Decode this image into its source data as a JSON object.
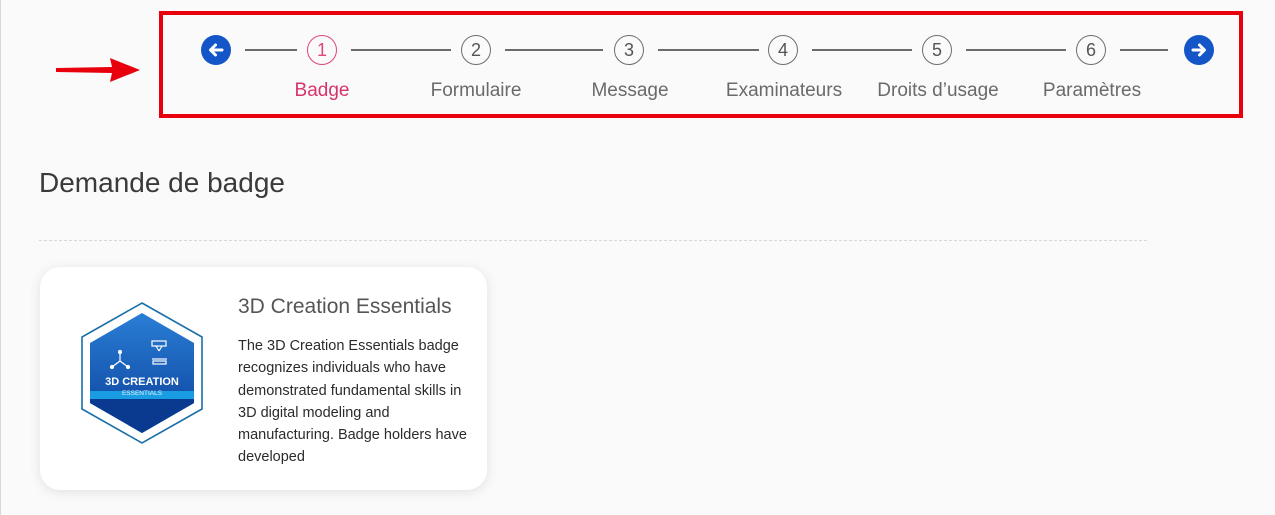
{
  "stepper": {
    "prev_icon": "arrow-left-icon",
    "next_icon": "arrow-right-icon",
    "active_color": "#d6336c",
    "nav_color": "#1456c8",
    "steps": [
      {
        "number": "1",
        "label": "Badge",
        "active": true
      },
      {
        "number": "2",
        "label": "Formulaire",
        "active": false
      },
      {
        "number": "3",
        "label": "Message",
        "active": false
      },
      {
        "number": "4",
        "label": "Examinateurs",
        "active": false
      },
      {
        "number": "5",
        "label": "Droits d’usage",
        "active": false
      },
      {
        "number": "6",
        "label": "Paramètres",
        "active": false
      }
    ]
  },
  "annotation": {
    "color": "#e8000d"
  },
  "page": {
    "title": "Demande de badge"
  },
  "badge": {
    "name": "3D Creation Essentials",
    "emblem_title": "3D CREATION",
    "emblem_subtitle": "ESSENTIALS",
    "description": "The 3D Creation Essentials badge recognizes individuals who have demonstrated fundamental skills in 3D digital modeling and manufacturing. Badge holders have developed"
  }
}
